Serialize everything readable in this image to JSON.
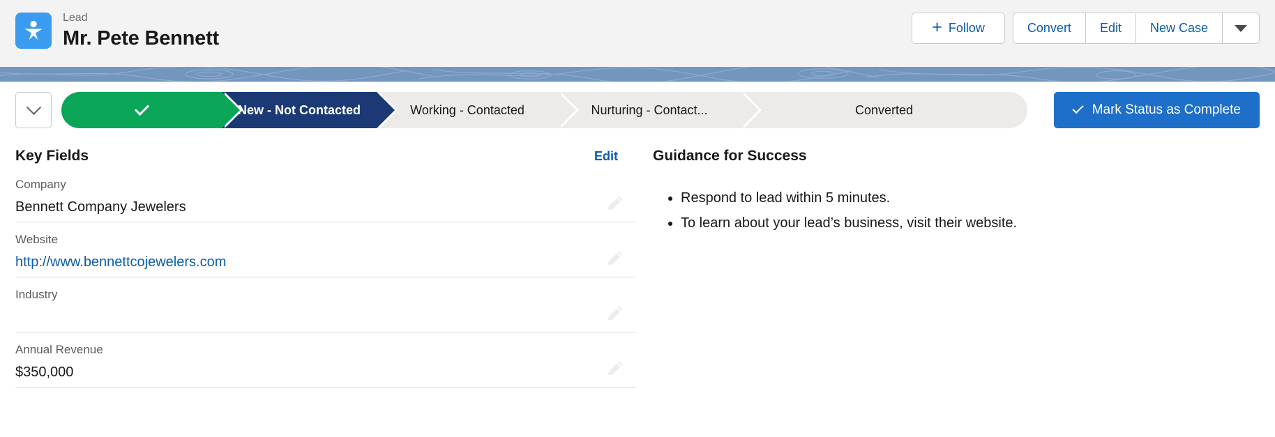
{
  "header": {
    "object_type": "Lead",
    "record_name": "Mr. Pete Bennett",
    "icon": "lead-person-icon",
    "icon_color": "#3b9bf0",
    "actions": {
      "follow": "Follow",
      "convert": "Convert",
      "edit": "Edit",
      "new_case": "New Case",
      "more": "chevron-down-icon"
    }
  },
  "path": {
    "toggle_icon": "chevron-down-icon",
    "steps": [
      {
        "label": "",
        "state": "complete",
        "icon": "check-icon"
      },
      {
        "label": "New - Not Contacted",
        "state": "current"
      },
      {
        "label": "Working - Contacted",
        "state": "incomplete"
      },
      {
        "label": "Nurturing - Contact...",
        "state": "incomplete"
      },
      {
        "label": "Converted",
        "state": "incomplete"
      }
    ],
    "mark_complete_label": "Mark Status as Complete",
    "mark_complete_icon": "check-icon",
    "colors": {
      "complete": "#0aa657",
      "current": "#1b3a75",
      "incomplete": "#ecebea",
      "button": "#1d6fc9"
    }
  },
  "key_fields": {
    "title": "Key Fields",
    "edit_label": "Edit",
    "fields": [
      {
        "label": "Company",
        "value": "Bennett Company Jewelers",
        "is_link": false,
        "edit_icon": "pencil-icon"
      },
      {
        "label": "Website",
        "value": "http://www.bennettcojewelers.com",
        "is_link": true,
        "edit_icon": "pencil-icon"
      },
      {
        "label": "Industry",
        "value": "",
        "is_link": false,
        "edit_icon": "pencil-icon"
      },
      {
        "label": "Annual Revenue",
        "value": "$350,000",
        "is_link": false,
        "edit_icon": "pencil-icon"
      }
    ]
  },
  "guidance": {
    "title": "Guidance for Success",
    "items": [
      "Respond to lead within 5 minutes.",
      "To learn about your lead’s business, visit their website."
    ]
  }
}
